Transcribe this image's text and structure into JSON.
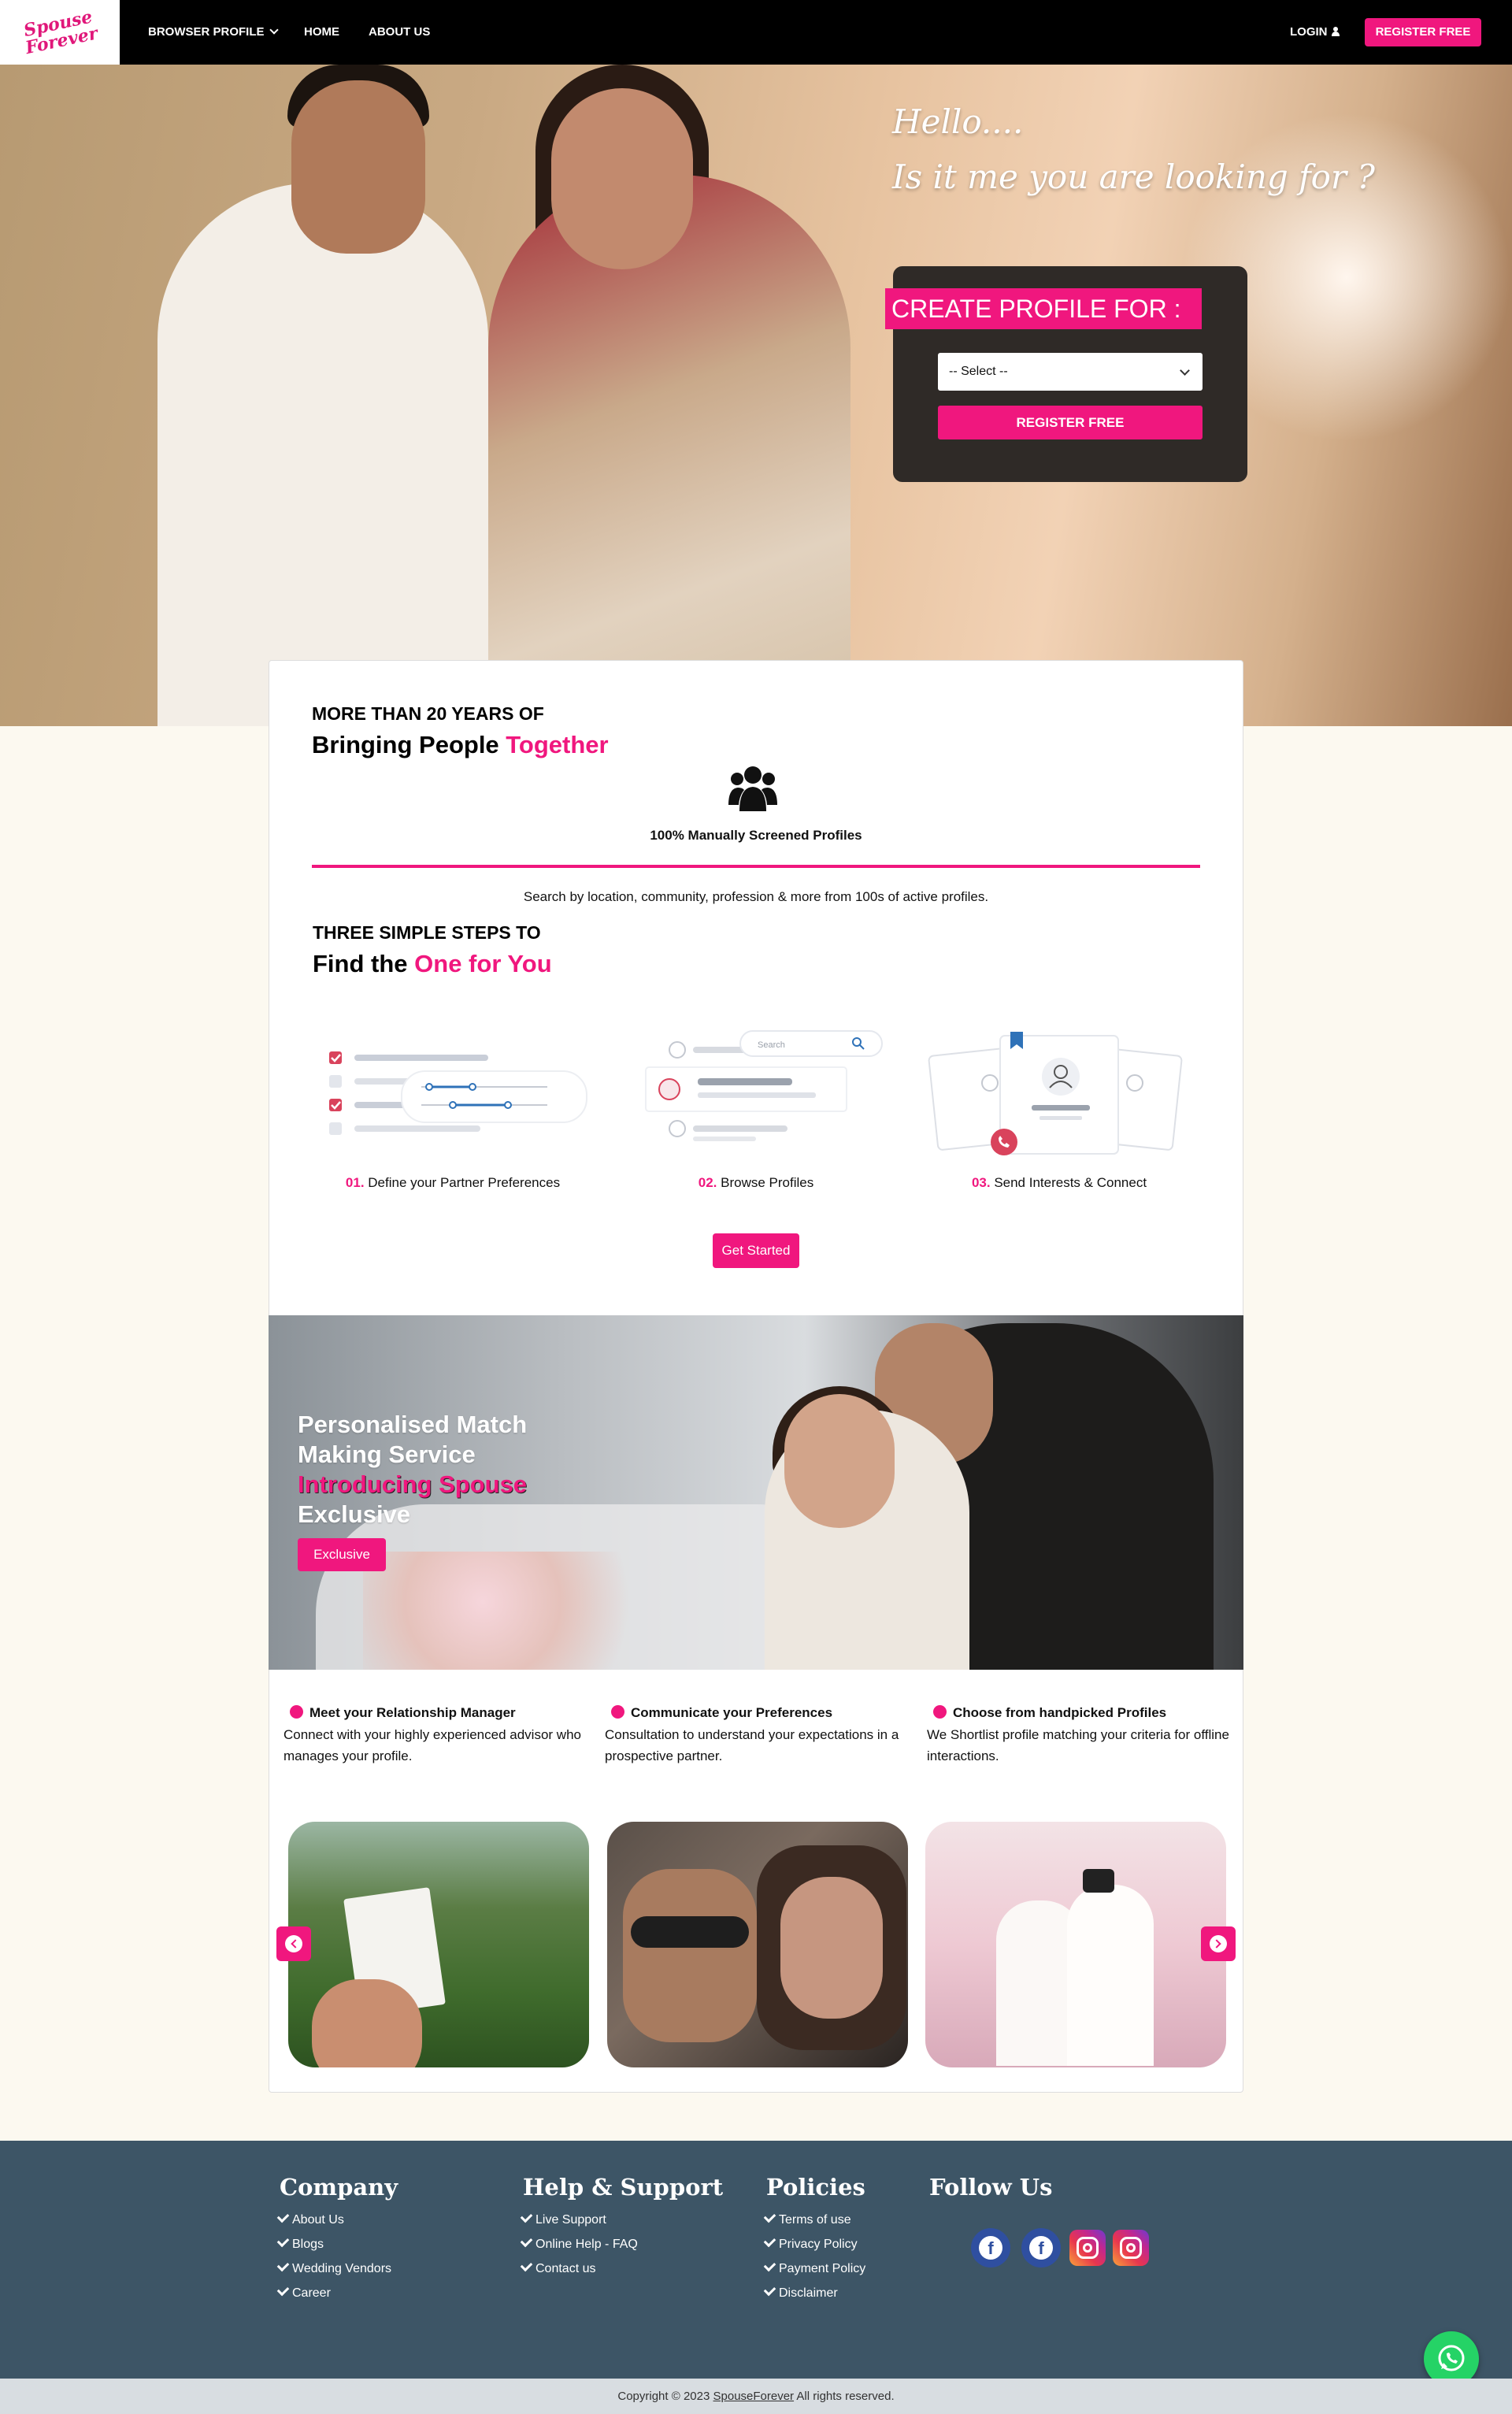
{
  "brand": {
    "logo_text": "Spouse Forever"
  },
  "nav": {
    "browse": "BROWSER PROFILE",
    "home": "HOME",
    "about": "ABOUT US",
    "login": "LOGIN",
    "register": "REGISTER FREE"
  },
  "hero": {
    "line1": "Hello....",
    "line2": "Is it me you are looking for ?",
    "create_label": "CREATE PROFILE FOR :",
    "select_value": "-- Select --",
    "register_button": "REGISTER FREE"
  },
  "intro": {
    "kicker": "MORE THAN 20 YEARS OF",
    "title_a": "Bringing People ",
    "title_b": "Together",
    "screened": "100% Manually Screened Profiles",
    "search_line": "Search by location, community, profession & more from 100s of active profiles."
  },
  "steps": {
    "kicker": "THREE SIMPLE STEPS TO",
    "title_a": "Find the ",
    "title_b": "One for You",
    "items": [
      {
        "num": "01.",
        "label": "Define your Partner Preferences"
      },
      {
        "num": "02.",
        "label": "Browse Profiles"
      },
      {
        "num": "03.",
        "label": "Send Interests & Connect"
      }
    ],
    "search_placeholder": "Search",
    "cta": "Get Started"
  },
  "exclusive": {
    "line1": "Personalised Match",
    "line2": "Making Service",
    "line3": "Introducing Spouse",
    "line4": "Exclusive",
    "button": "Exclusive"
  },
  "features": [
    {
      "title": "Meet your Relationship Manager",
      "desc": "Connect with your highly experienced advisor who manages your profile."
    },
    {
      "title": "Communicate your Preferences",
      "desc": "Consultation to understand your expectations in a prospective partner."
    },
    {
      "title": "Choose from handpicked Profiles",
      "desc": "We Shortlist profile matching your criteria for offline interactions."
    }
  ],
  "footer": {
    "company": {
      "title": "Company",
      "links": [
        "About Us",
        "Blogs",
        "Wedding Vendors",
        "Career"
      ]
    },
    "help": {
      "title": "Help & Support",
      "links": [
        "Live Support",
        "Online Help - FAQ",
        "Contact us"
      ]
    },
    "policies": {
      "title": "Policies",
      "links": [
        "Terms of use",
        "Privacy Policy",
        "Payment Policy",
        "Disclaimer"
      ]
    },
    "follow": {
      "title": "Follow Us",
      "icons": [
        "facebook-icon",
        "facebook-icon",
        "instagram-icon",
        "instagram-icon"
      ]
    },
    "copyright_pre": "Copyright © 2023 ",
    "copyright_link": "SpouseForever",
    "copyright_post": " All rights reserved."
  },
  "colors": {
    "accent": "#f0177e",
    "footer": "#3d5566",
    "nav": "#000000",
    "whatsapp": "#25d366"
  }
}
